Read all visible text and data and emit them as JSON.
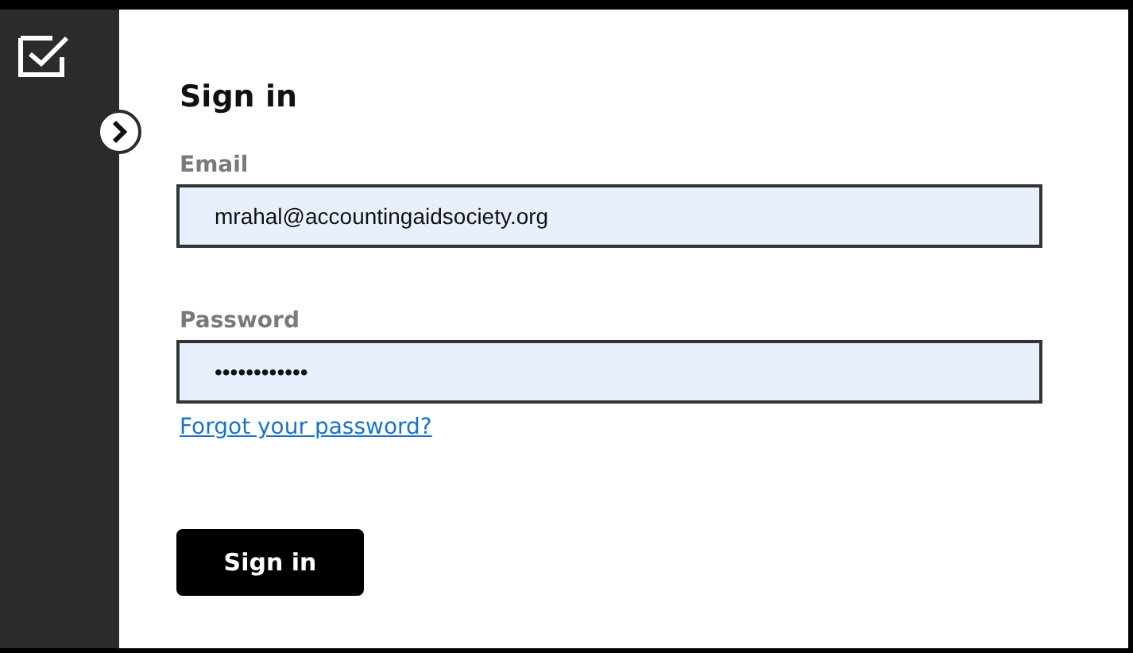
{
  "title": "Sign in",
  "fields": [
    {
      "label": "Email",
      "value": "mrahal@accountingaidsociety.org"
    },
    {
      "label": "Password",
      "value": "••••••••••••"
    }
  ],
  "forgot_link": "Forgot your password?",
  "submit": "Sign in"
}
